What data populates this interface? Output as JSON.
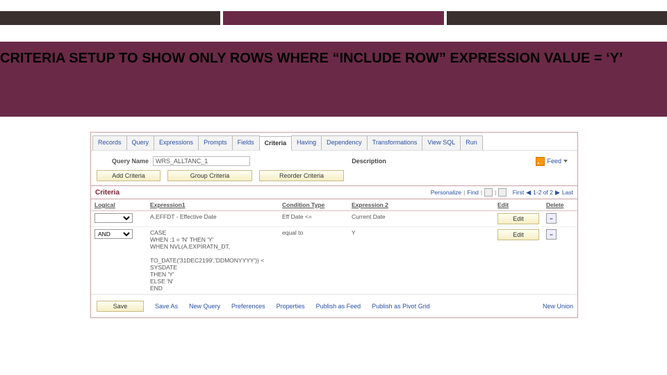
{
  "slide": {
    "title": "CRITERIA SETUP TO SHOW ONLY ROWS WHERE “INCLUDE ROW” EXPRESSION VALUE = ‘Y’"
  },
  "tabs": [
    "Records",
    "Query",
    "Expressions",
    "Prompts",
    "Fields",
    "Criteria",
    "Having",
    "Dependency",
    "Transformations",
    "View SQL",
    "Run"
  ],
  "queryName": {
    "label": "Query Name",
    "value": "WRS_ALLTANC_1"
  },
  "descLabel": "Description",
  "feedLabel": "Feed",
  "actionButtons": {
    "add": "Add Criteria",
    "group": "Group Criteria",
    "reorder": "Reorder Criteria"
  },
  "section": {
    "title": "Criteria",
    "personalize": "Personalize",
    "find": "Find",
    "first": "First",
    "counter": "1-2 of 2",
    "last": "Last"
  },
  "grid": {
    "headers": {
      "logical": "Logical",
      "expr1": "Expression1",
      "cond": "Condition Type",
      "expr2": "Expression 2",
      "edit": "Edit",
      "del": "Delete"
    },
    "rows": [
      {
        "logical": "",
        "expr1": "A.EFFDT - Effective Date",
        "cond": "Eff Date <=",
        "expr2": "Current Date",
        "edit": "Edit"
      },
      {
        "logical": "AND",
        "expr1": "CASE\nWHEN :1 = 'N' THEN 'Y'\nWHEN NVL(A.EXPIRATN_DT,\n\nTO_DATE('31DEC2199','DDMONYYYY')) < SYSDATE\n   THEN 'Y'\n   ELSE 'N'\n   END",
        "cond": "equal to",
        "expr2": "Y",
        "edit": "Edit"
      }
    ]
  },
  "bottom": {
    "save": "Save",
    "saveAs": "Save As",
    "newQuery": "New Query",
    "prefs": "Preferences",
    "props": "Properties",
    "pubFeed": "Publish as Feed",
    "pubPivot": "Publish as Pivot Grid",
    "newUnion": "New Union"
  }
}
